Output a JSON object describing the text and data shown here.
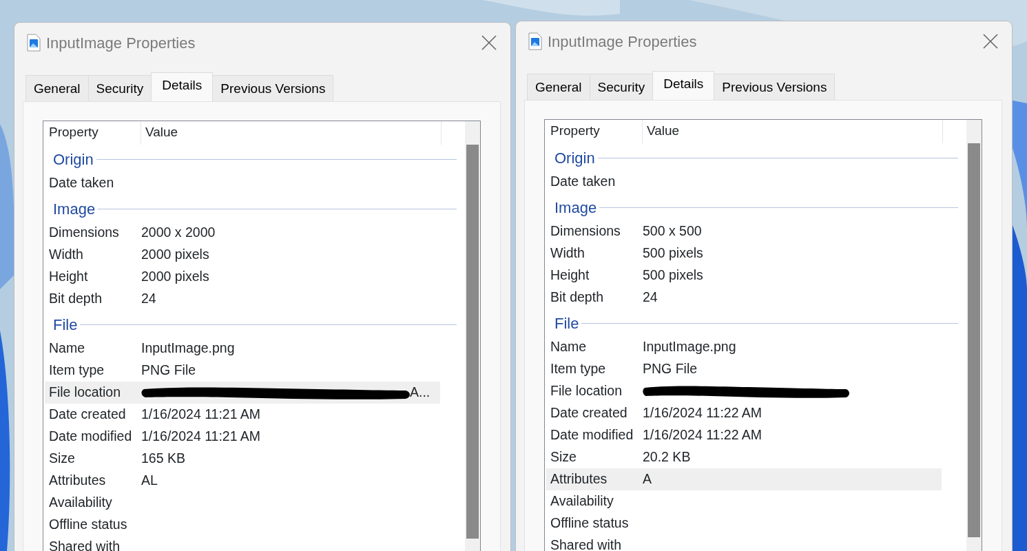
{
  "windows": [
    {
      "title": "InputImage Properties",
      "tabs": [
        {
          "label": "General",
          "selected": false
        },
        {
          "label": "Security",
          "selected": false
        },
        {
          "label": "Details",
          "selected": true
        },
        {
          "label": "Previous Versions",
          "selected": false
        }
      ],
      "columns": [
        "Property",
        "Value"
      ],
      "rows": [
        {
          "kind": "group",
          "label": "Origin"
        },
        {
          "kind": "row",
          "label": "Date taken",
          "selected": false
        },
        {
          "kind": "group",
          "label": "Image"
        },
        {
          "kind": "row",
          "label": "Dimensions",
          "value": "2000 x 2000",
          "selected": false
        },
        {
          "kind": "row",
          "label": "Width",
          "value": "2000 pixels",
          "selected": false
        },
        {
          "kind": "row",
          "label": "Height",
          "value": "2000 pixels",
          "selected": false
        },
        {
          "kind": "row",
          "label": "Bit depth",
          "value": "24",
          "selected": false
        },
        {
          "kind": "group",
          "label": "File"
        },
        {
          "kind": "row",
          "label": "Name",
          "value": "InputImage.png",
          "selected": false
        },
        {
          "kind": "row",
          "label": "Item type",
          "value": "PNG File",
          "selected": false
        },
        {
          "kind": "row",
          "label": "File location",
          "value": "A...",
          "redacted": true,
          "selected": true
        },
        {
          "kind": "row",
          "label": "Date created",
          "value": "1/16/2024 11:21 AM",
          "selected": false
        },
        {
          "kind": "row",
          "label": "Date modified",
          "value": "1/16/2024 11:21 AM",
          "selected": false
        },
        {
          "kind": "row",
          "label": "Size",
          "value": "165 KB",
          "selected": false
        },
        {
          "kind": "row",
          "label": "Attributes",
          "value": "AL",
          "selected": false
        },
        {
          "kind": "row",
          "label": "Availability",
          "selected": false
        },
        {
          "kind": "row",
          "label": "Offline status",
          "selected": false
        },
        {
          "kind": "row",
          "label": "Shared with",
          "selected": false
        }
      ]
    },
    {
      "title": "InputImage Properties",
      "tabs": [
        {
          "label": "General",
          "selected": false
        },
        {
          "label": "Security",
          "selected": false
        },
        {
          "label": "Details",
          "selected": true
        },
        {
          "label": "Previous Versions",
          "selected": false
        }
      ],
      "columns": [
        "Property",
        "Value"
      ],
      "rows": [
        {
          "kind": "group",
          "label": "Origin"
        },
        {
          "kind": "row",
          "label": "Date taken",
          "selected": false
        },
        {
          "kind": "group",
          "label": "Image"
        },
        {
          "kind": "row",
          "label": "Dimensions",
          "value": "500 x 500",
          "selected": false
        },
        {
          "kind": "row",
          "label": "Width",
          "value": "500 pixels",
          "selected": false
        },
        {
          "kind": "row",
          "label": "Height",
          "value": "500 pixels",
          "selected": false
        },
        {
          "kind": "row",
          "label": "Bit depth",
          "value": "24",
          "selected": false
        },
        {
          "kind": "group",
          "label": "File"
        },
        {
          "kind": "row",
          "label": "Name",
          "value": "InputImage.png",
          "selected": false
        },
        {
          "kind": "row",
          "label": "Item type",
          "value": "PNG File",
          "selected": false
        },
        {
          "kind": "row",
          "label": "File location",
          "redacted": true,
          "selected": false
        },
        {
          "kind": "row",
          "label": "Date created",
          "value": "1/16/2024 11:22 AM",
          "selected": false
        },
        {
          "kind": "row",
          "label": "Date modified",
          "value": "1/16/2024 11:22 AM",
          "selected": false
        },
        {
          "kind": "row",
          "label": "Size",
          "value": "20.2 KB",
          "selected": false
        },
        {
          "kind": "row",
          "label": "Attributes",
          "value": "A",
          "selected": true
        },
        {
          "kind": "row",
          "label": "Availability",
          "selected": false
        },
        {
          "kind": "row",
          "label": "Offline status",
          "selected": false
        },
        {
          "kind": "row",
          "label": "Shared with",
          "selected": false
        }
      ]
    }
  ]
}
